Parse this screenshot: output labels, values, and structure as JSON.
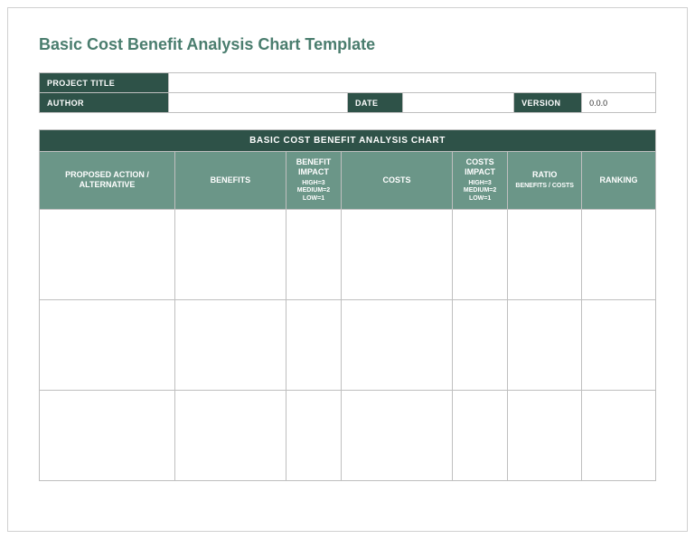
{
  "title": "Basic Cost Benefit Analysis Chart Template",
  "meta": {
    "projectTitleLabel": "PROJECT TITLE",
    "projectTitleValue": "",
    "authorLabel": "AUTHOR",
    "authorValue": "",
    "dateLabel": "DATE",
    "dateValue": "",
    "versionLabel": "VERSION",
    "versionValue": "0.0.0"
  },
  "chart": {
    "banner": "BASIC COST BENEFIT ANALYSIS CHART",
    "headers": {
      "proposed": "PROPOSED ACTION / ALTERNATIVE",
      "benefits": "BENEFITS",
      "benefitImpact": "BENEFIT IMPACT",
      "benefitImpactSub": "HIGH=3 MEDIUM=2 LOW=1",
      "costs": "COSTS",
      "costsImpact": "COSTS IMPACT",
      "costsImpactSub": "HIGH=3 MEDIUM=2 LOW=1",
      "ratio": "RATIO",
      "ratioSub": "BENEFITS / COSTS",
      "ranking": "RANKING"
    }
  }
}
